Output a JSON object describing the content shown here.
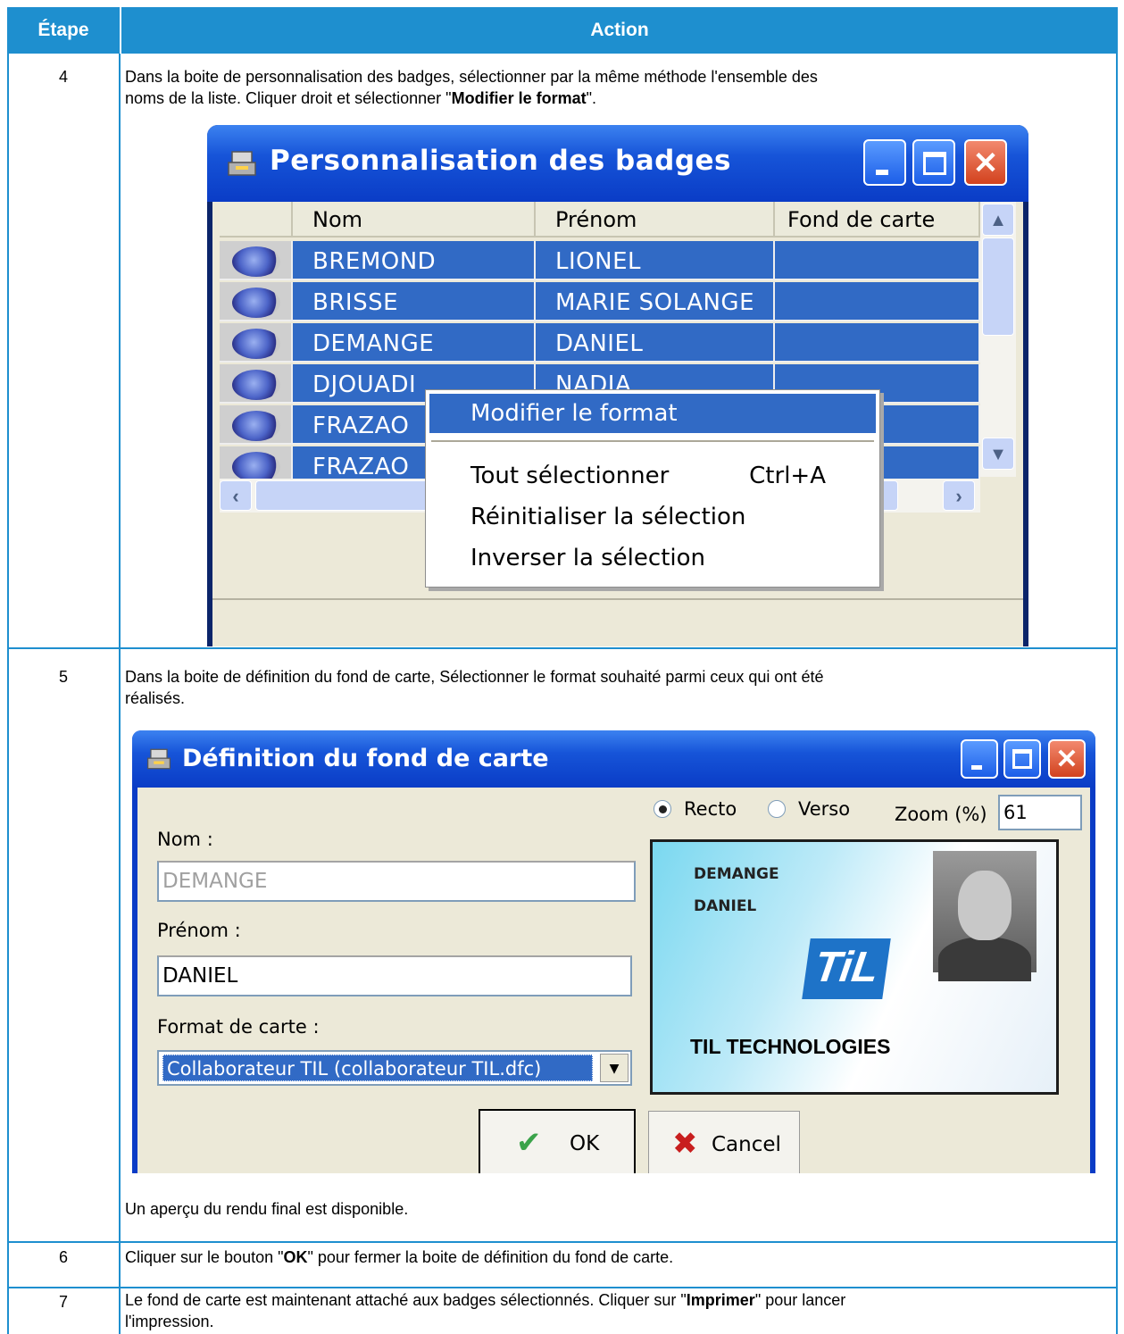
{
  "table": {
    "header_step": "Étape",
    "header_action": "Action",
    "rows": [
      {
        "step": "4",
        "text_line1": "Dans la boite de personnalisation des badges, sélectionner par la même méthode l'ensemble des",
        "text_line2_prefix": "noms de la liste. Cliquer droit et sélectionner \"",
        "text_line2_bold": "Modifier le format",
        "text_line2_suffix": "\"."
      },
      {
        "step": "5",
        "text_line1": "Dans la boite de définition du fond de carte, Sélectionner le format souhaité parmi ceux qui ont été",
        "text_line2": "réalisés.",
        "note": "Un aperçu du rendu final est disponible."
      },
      {
        "step": "6",
        "text_prefix": "Cliquer sur le bouton \"",
        "text_bold": "OK",
        "text_suffix": "\" pour fermer la boite de définition du fond de carte."
      },
      {
        "step": "7",
        "text_line1_prefix": "Le fond de carte est maintenant attaché aux badges sélectionnés. Cliquer sur \"",
        "text_line1_bold": "Imprimer",
        "text_line1_suffix": "\" pour lancer",
        "text_line2": "l'impression."
      }
    ]
  },
  "window_badges": {
    "title": "Personnalisation des badges",
    "title_icon": "app-icon",
    "columns": [
      "Nom",
      "Prénom",
      "Fond de carte"
    ],
    "rows": [
      {
        "nom": "BREMOND",
        "prenom": "LIONEL",
        "fond": ""
      },
      {
        "nom": "BRISSE",
        "prenom": "MARIE SOLANGE",
        "fond": ""
      },
      {
        "nom": "DEMANGE",
        "prenom": "DANIEL",
        "fond": ""
      },
      {
        "nom": "DJOUADI",
        "prenom": "NADIA",
        "fond": ""
      },
      {
        "nom": "FRAZAO",
        "prenom": "",
        "fond": ""
      },
      {
        "nom": "FRAZAO",
        "prenom": "",
        "fond": ""
      }
    ],
    "context_menu": {
      "items": [
        {
          "label": "Modifier le format",
          "shortcut": "",
          "selected": true
        },
        {
          "label": "Tout sélectionner",
          "shortcut": "Ctrl+A",
          "selected": false
        },
        {
          "label": "Réinitialiser la sélection",
          "shortcut": "",
          "selected": false
        },
        {
          "label": "Inverser la sélection",
          "shortcut": "",
          "selected": false
        }
      ]
    }
  },
  "window_fond": {
    "title": "Définition du fond de carte",
    "title_icon": "app-icon",
    "nom_label": "Nom :",
    "nom_value": "DEMANGE",
    "prenom_label": "Prénom :",
    "prenom_value": "DANIEL",
    "format_label": "Format de carte :",
    "format_value": "Collaborateur TIL (collaborateur TIL.dfc)",
    "recto_label": "Recto",
    "verso_label": "Verso",
    "face_selected": "Recto",
    "zoom_label": "Zoom (%)",
    "zoom_value": "61",
    "preview": {
      "nom": "DEMANGE",
      "prenom": "DANIEL",
      "logo": "TiL",
      "company": "TIL TECHNOLOGIES"
    },
    "ok_label": "OK",
    "cancel_label": "Cancel"
  },
  "colors": {
    "table_accent": "#1e8fcf",
    "selection": "#316ac5",
    "xp_title": "#0a3cc6"
  }
}
